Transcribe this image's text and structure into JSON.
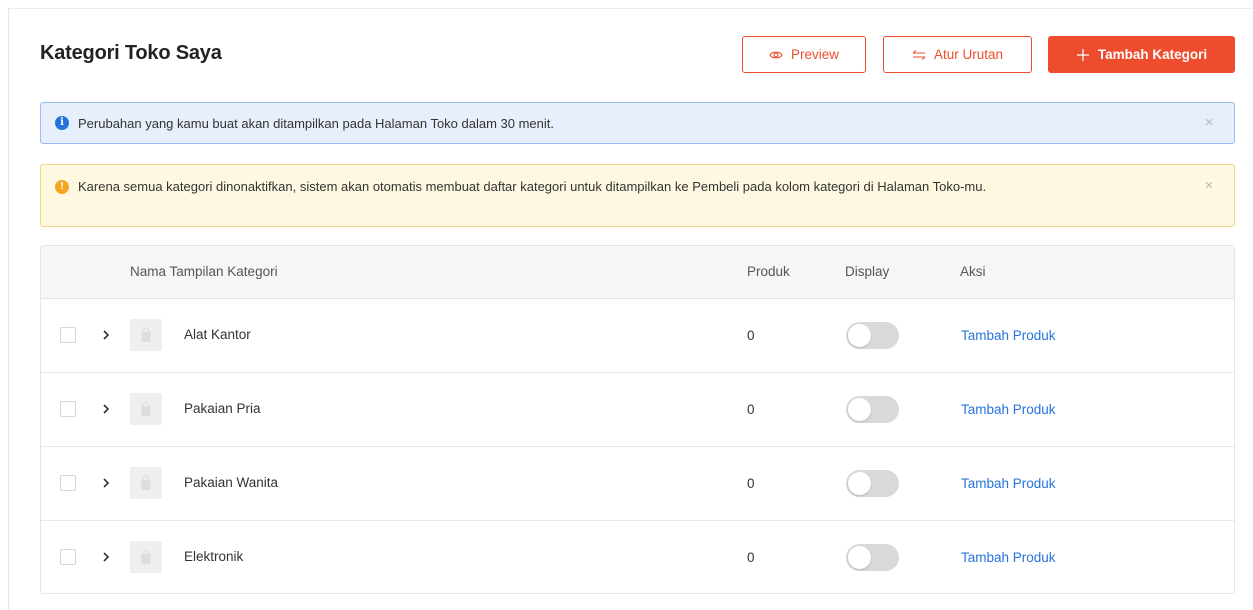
{
  "page": {
    "title": "Kategori Toko Saya"
  },
  "toolbar": {
    "preview_label": "Preview",
    "preview_icon": "eye-icon",
    "sort_label": "Atur Urutan",
    "sort_icon": "swap-arrows-icon",
    "add_label": "Tambah Kategori",
    "add_icon": "plus-icon"
  },
  "alerts": {
    "info": {
      "icon": "info-icon",
      "text": "Perubahan yang kamu buat akan ditampilkan pada Halaman Toko dalam 30 menit."
    },
    "warning": {
      "icon": "warning-icon",
      "text": "Karena semua kategori dinonaktifkan, sistem akan otomatis membuat daftar kategori untuk ditampilkan ke Pembeli pada kolom kategori di Halaman Toko-mu."
    }
  },
  "table": {
    "columns": {
      "name": "Nama Tampilan Kategori",
      "produk": "Produk",
      "display": "Display",
      "aksi": "Aksi"
    },
    "rows": [
      {
        "name": "Alat Kantor",
        "produk": "0",
        "display_on": false,
        "action": "Tambah Produk"
      },
      {
        "name": "Pakaian Pria",
        "produk": "0",
        "display_on": false,
        "action": "Tambah Produk"
      },
      {
        "name": "Pakaian Wanita",
        "produk": "0",
        "display_on": false,
        "action": "Tambah Produk"
      },
      {
        "name": "Elektronik",
        "produk": "0",
        "display_on": false,
        "action": "Tambah Produk"
      }
    ]
  },
  "colors": {
    "brand": "#ee4d2d",
    "link": "#2673dd",
    "info_bg": "#e6effb",
    "warn_bg": "#fff8e1",
    "toggle_off": "#d9d9d9"
  }
}
